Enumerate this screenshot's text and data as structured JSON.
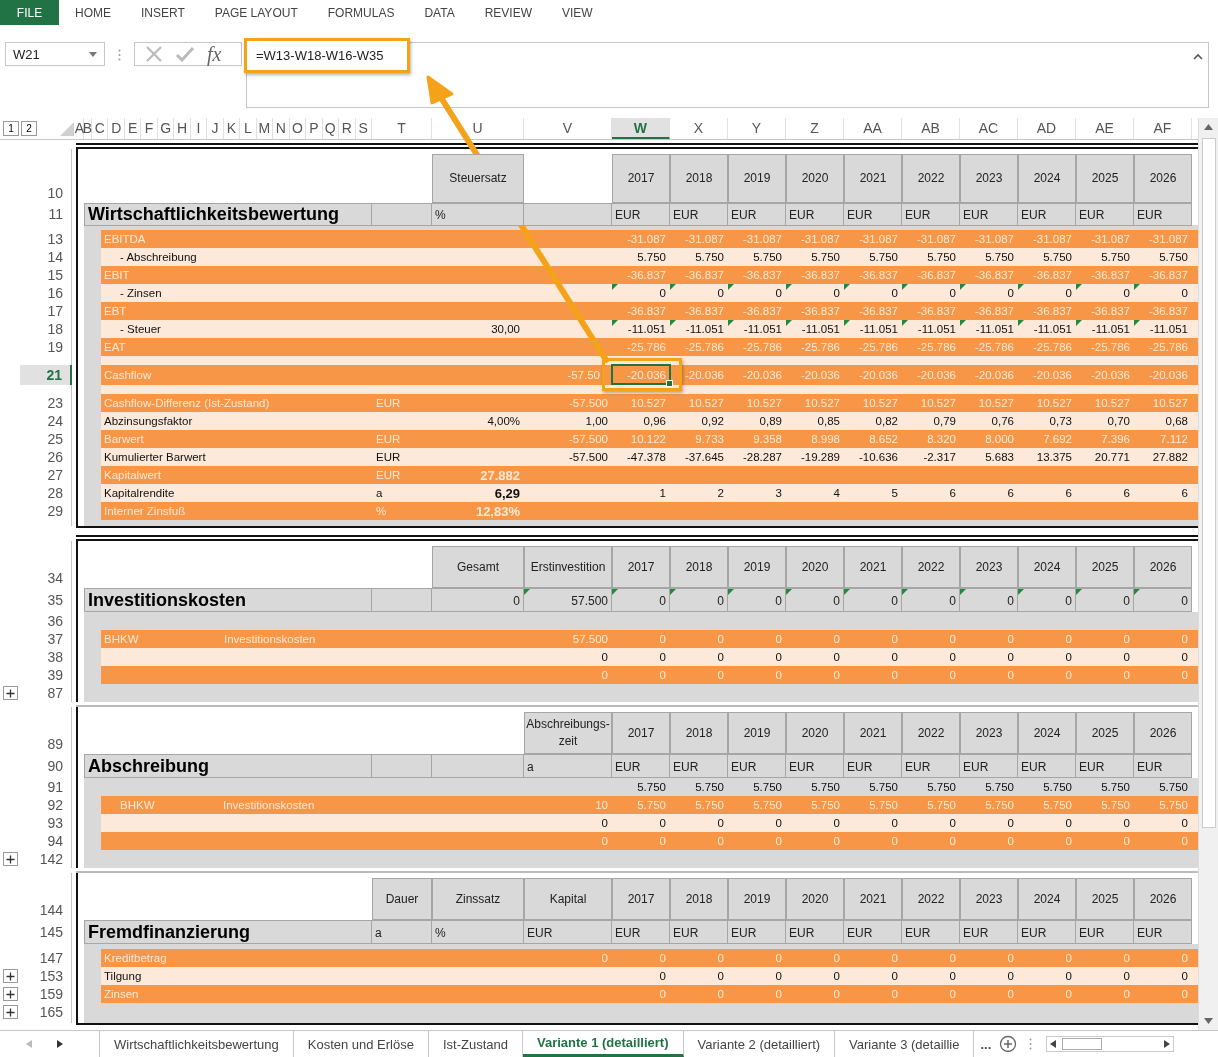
{
  "menu": {
    "file": "FILE",
    "tabs": [
      "HOME",
      "INSERT",
      "PAGE LAYOUT",
      "FORMULAS",
      "DATA",
      "REVIEW",
      "VIEW"
    ]
  },
  "formula_bar": {
    "name_box": "W21",
    "function_symbol": "fx",
    "formula": "=W13-W18-W16-W35"
  },
  "outline_levels": [
    "1",
    "2"
  ],
  "columns": [
    {
      "label": "A",
      "selected": false
    },
    {
      "label": "B",
      "selected": false
    },
    {
      "label": "C",
      "selected": false
    },
    {
      "label": "D",
      "selected": false
    },
    {
      "label": "E",
      "selected": false
    },
    {
      "label": "F",
      "selected": false
    },
    {
      "label": "G",
      "selected": false
    },
    {
      "label": "H",
      "selected": false
    },
    {
      "label": "I",
      "selected": false
    },
    {
      "label": "J",
      "selected": false
    },
    {
      "label": "K",
      "selected": false
    },
    {
      "label": "L",
      "selected": false
    },
    {
      "label": "M",
      "selected": false
    },
    {
      "label": "N",
      "selected": false
    },
    {
      "label": "O",
      "selected": false
    },
    {
      "label": "P",
      "selected": false
    },
    {
      "label": "Q",
      "selected": false
    },
    {
      "label": "R",
      "selected": false
    },
    {
      "label": "S",
      "selected": false
    },
    {
      "label": "T",
      "selected": false
    },
    {
      "label": "U",
      "selected": false
    },
    {
      "label": "V",
      "selected": false
    },
    {
      "label": "W",
      "selected": true
    },
    {
      "label": "X",
      "selected": false
    },
    {
      "label": "Y",
      "selected": false
    },
    {
      "label": "Z",
      "selected": false
    },
    {
      "label": "AA",
      "selected": false
    },
    {
      "label": "AB",
      "selected": false
    },
    {
      "label": "AC",
      "selected": false
    },
    {
      "label": "AD",
      "selected": false
    },
    {
      "label": "AE",
      "selected": false
    },
    {
      "label": "AF",
      "selected": false
    }
  ],
  "sections": [
    {
      "header": {
        "num": "10",
        "u": "Steuersatz",
        "years": [
          "2017",
          "2018",
          "2019",
          "2020",
          "2021",
          "2022",
          "2023",
          "2024",
          "2025",
          "2026"
        ]
      },
      "title": {
        "num": "11",
        "text": "Wirtschaftlichkeitsbewertung",
        "u": "%",
        "numeric": false,
        "flagged": false,
        "years": [
          "EUR",
          "EUR",
          "EUR",
          "EUR",
          "EUR",
          "EUR",
          "EUR",
          "EUR",
          "EUR",
          "EUR"
        ]
      },
      "rows": [
        {
          "num": "13",
          "kind": "orange",
          "label": "EBITDA",
          "sub": false,
          "flagged": false,
          "selected": false,
          "collapsed": false,
          "years": [
            "-31.087",
            "-31.087",
            "-31.087",
            "-31.087",
            "-31.087",
            "-31.087",
            "-31.087",
            "-31.087",
            "-31.087",
            "-31.087"
          ]
        },
        {
          "num": "14",
          "kind": "light",
          "label": "- Abschreibung",
          "sub": true,
          "flagged": false,
          "selected": false,
          "collapsed": false,
          "years": [
            "5.750",
            "5.750",
            "5.750",
            "5.750",
            "5.750",
            "5.750",
            "5.750",
            "5.750",
            "5.750",
            "5.750"
          ]
        },
        {
          "num": "15",
          "kind": "orange",
          "label": "EBIT",
          "sub": false,
          "flagged": false,
          "selected": false,
          "collapsed": false,
          "years": [
            "-36.837",
            "-36.837",
            "-36.837",
            "-36.837",
            "-36.837",
            "-36.837",
            "-36.837",
            "-36.837",
            "-36.837",
            "-36.837"
          ]
        },
        {
          "num": "16",
          "kind": "light",
          "label": "- Zinsen",
          "sub": true,
          "flagged": true,
          "selected": false,
          "collapsed": false,
          "years": [
            "0",
            "0",
            "0",
            "0",
            "0",
            "0",
            "0",
            "0",
            "0",
            "0"
          ]
        },
        {
          "num": "17",
          "kind": "orange",
          "label": "EBT",
          "sub": false,
          "flagged": false,
          "selected": false,
          "collapsed": false,
          "years": [
            "-36.837",
            "-36.837",
            "-36.837",
            "-36.837",
            "-36.837",
            "-36.837",
            "-36.837",
            "-36.837",
            "-36.837",
            "-36.837"
          ]
        },
        {
          "num": "18",
          "kind": "light",
          "label": "- Steuer",
          "sub": true,
          "u": "30,00",
          "emphasis": false,
          "flagged": true,
          "selected": false,
          "collapsed": false,
          "years": [
            "-11.051",
            "-11.051",
            "-11.051",
            "-11.051",
            "-11.051",
            "-11.051",
            "-11.051",
            "-11.051",
            "-11.051",
            "-11.051"
          ]
        },
        {
          "num": "19",
          "kind": "orange",
          "label": "EAT",
          "sub": false,
          "flagged": false,
          "selected": false,
          "collapsed": false,
          "years": [
            "-25.786",
            "-25.786",
            "-25.786",
            "-25.786",
            "-25.786",
            "-25.786",
            "-25.786",
            "-25.786",
            "-25.786",
            "-25.786"
          ]
        },
        {
          "kind": "light",
          "selected": false,
          "collapsed": false
        },
        {
          "num": "21",
          "kind": "orange",
          "label": "Cashflow",
          "sub": false,
          "v": "-57.50",
          "flagged": false,
          "selected": true,
          "collapsed": false,
          "years": [
            "-20.036",
            "-20.036",
            "-20.036",
            "-20.036",
            "-20.036",
            "-20.036",
            "-20.036",
            "-20.036",
            "-20.036",
            "-20.036"
          ]
        },
        {
          "kind": "light",
          "selected": false,
          "collapsed": false
        },
        {
          "num": "23",
          "kind": "orange",
          "label": "Cashflow-Differenz (Ist-Zustand)",
          "sub": false,
          "t": "EUR",
          "v": "-57.500",
          "flagged": false,
          "selected": false,
          "collapsed": false,
          "years": [
            "10.527",
            "10.527",
            "10.527",
            "10.527",
            "10.527",
            "10.527",
            "10.527",
            "10.527",
            "10.527",
            "10.527"
          ]
        },
        {
          "num": "24",
          "kind": "light",
          "label": "Abzinsungsfaktor",
          "sub": false,
          "u": "4,00%",
          "emphasis": false,
          "v": "1,00",
          "flagged": false,
          "selected": false,
          "collapsed": false,
          "years": [
            "0,96",
            "0,92",
            "0,89",
            "0,85",
            "0,82",
            "0,79",
            "0,76",
            "0,73",
            "0,70",
            "0,68"
          ]
        },
        {
          "num": "25",
          "kind": "orange",
          "label": "Barwert",
          "sub": false,
          "t": "EUR",
          "v": "-57.500",
          "flagged": false,
          "selected": false,
          "collapsed": false,
          "years": [
            "10.122",
            "9.733",
            "9.358",
            "8.998",
            "8.652",
            "8.320",
            "8.000",
            "7.692",
            "7.396",
            "7.112"
          ]
        },
        {
          "num": "26",
          "kind": "light",
          "label": "Kumulierter Barwert",
          "sub": false,
          "t": "EUR",
          "v": "-57.500",
          "flagged": false,
          "selected": false,
          "collapsed": false,
          "years": [
            "-47.378",
            "-37.645",
            "-28.287",
            "-19.289",
            "-10.636",
            "-2.317",
            "5.683",
            "13.375",
            "20.771",
            "27.882"
          ]
        },
        {
          "num": "27",
          "kind": "orange",
          "label": "Kapitalwert",
          "sub": false,
          "t": "EUR",
          "u": "27.882",
          "emphasis": true,
          "selected": false,
          "collapsed": false
        },
        {
          "num": "28",
          "kind": "light",
          "label": "Kapitalrendite",
          "sub": false,
          "t": "a",
          "u": "6,29",
          "emphasis": true,
          "flagged": false,
          "selected": false,
          "collapsed": false,
          "years": [
            "1",
            "2",
            "3",
            "4",
            "5",
            "6",
            "6",
            "6",
            "6",
            "6"
          ]
        },
        {
          "num": "29",
          "kind": "orange",
          "label": "Interner Zinsfuß",
          "sub": false,
          "t": "%",
          "u": "12,83%",
          "emphasis": true,
          "selected": false,
          "collapsed": false
        }
      ]
    },
    {
      "header": {
        "num": "34",
        "u": "Gesamt",
        "v": "Erstinvestition",
        "years": [
          "2017",
          "2018",
          "2019",
          "2020",
          "2021",
          "2022",
          "2023",
          "2024",
          "2025",
          "2026"
        ]
      },
      "title": {
        "num": "35",
        "text": "Investitionskosten",
        "u": "0",
        "v": "57.500",
        "numeric": true,
        "flagged": true,
        "years": [
          "0",
          "0",
          "0",
          "0",
          "0",
          "0",
          "0",
          "0",
          "0",
          "0"
        ]
      },
      "rows": [
        {
          "num": "36",
          "kind": "gray",
          "selected": false,
          "collapsed": false
        },
        {
          "num": "37",
          "kind": "orange",
          "label": "BHKW",
          "label2": "Investitionskosten",
          "sub": false,
          "v": "57.500",
          "flagged": false,
          "selected": false,
          "collapsed": false,
          "years": [
            "0",
            "0",
            "0",
            "0",
            "0",
            "0",
            "0",
            "0",
            "0",
            "0"
          ]
        },
        {
          "num": "38",
          "kind": "light",
          "v": "0",
          "flagged": false,
          "selected": false,
          "collapsed": false,
          "years": [
            "0",
            "0",
            "0",
            "0",
            "0",
            "0",
            "0",
            "0",
            "0",
            "0"
          ]
        },
        {
          "num": "39",
          "kind": "orange",
          "v": "0",
          "flagged": false,
          "selected": false,
          "collapsed": false,
          "years": [
            "0",
            "0",
            "0",
            "0",
            "0",
            "0",
            "0",
            "0",
            "0",
            "0"
          ]
        },
        {
          "num": "87",
          "kind": "gray",
          "selected": false,
          "collapsed": true
        }
      ]
    },
    {
      "header": {
        "num": "89",
        "v": "Abschreibungs-zeit",
        "years": [
          "2017",
          "2018",
          "2019",
          "2020",
          "2021",
          "2022",
          "2023",
          "2024",
          "2025",
          "2026"
        ]
      },
      "title": {
        "num": "90",
        "text": "Abschreibung",
        "v": "a",
        "numeric": false,
        "flagged": false,
        "years": [
          "EUR",
          "EUR",
          "EUR",
          "EUR",
          "EUR",
          "EUR",
          "EUR",
          "EUR",
          "EUR",
          "EUR"
        ]
      },
      "rows": [
        {
          "num": "91",
          "kind": "gray",
          "flagged": false,
          "selected": false,
          "collapsed": false,
          "years": [
            "5.750",
            "5.750",
            "5.750",
            "5.750",
            "5.750",
            "5.750",
            "5.750",
            "5.750",
            "5.750",
            "5.750"
          ]
        },
        {
          "num": "92",
          "kind": "orange",
          "label": "BHKW",
          "label2": "Investitionskosten",
          "sub": true,
          "v": "10",
          "flagged": false,
          "selected": false,
          "collapsed": false,
          "years": [
            "5.750",
            "5.750",
            "5.750",
            "5.750",
            "5.750",
            "5.750",
            "5.750",
            "5.750",
            "5.750",
            "5.750"
          ]
        },
        {
          "num": "93",
          "kind": "light",
          "v": "0",
          "flagged": false,
          "selected": false,
          "collapsed": false,
          "years": [
            "0",
            "0",
            "0",
            "0",
            "0",
            "0",
            "0",
            "0",
            "0",
            "0"
          ]
        },
        {
          "num": "94",
          "kind": "orange",
          "v": "0",
          "flagged": false,
          "selected": false,
          "collapsed": false,
          "years": [
            "0",
            "0",
            "0",
            "0",
            "0",
            "0",
            "0",
            "0",
            "0",
            "0"
          ]
        },
        {
          "num": "142",
          "kind": "gray",
          "selected": false,
          "collapsed": true
        }
      ]
    },
    {
      "header": {
        "num": "144",
        "t": "Dauer",
        "u": "Zinssatz",
        "v": "Kapital",
        "years": [
          "2017",
          "2018",
          "2019",
          "2020",
          "2021",
          "2022",
          "2023",
          "2024",
          "2025",
          "2026"
        ]
      },
      "title": {
        "num": "145",
        "text": "Fremdfinanzierung",
        "t": "a",
        "u": "%",
        "v": "EUR",
        "numeric": false,
        "flagged": false,
        "years": [
          "EUR",
          "EUR",
          "EUR",
          "EUR",
          "EUR",
          "EUR",
          "EUR",
          "EUR",
          "EUR",
          "EUR"
        ]
      },
      "rows": [
        {
          "num": "147",
          "kind": "orange",
          "label": "Kreditbetrag",
          "sub": false,
          "v": "0",
          "flagged": false,
          "selected": false,
          "collapsed": false,
          "years": [
            "0",
            "0",
            "0",
            "0",
            "0",
            "0",
            "0",
            "0",
            "0",
            "0"
          ]
        },
        {
          "num": "153",
          "kind": "light",
          "label": "Tilgung",
          "sub": false,
          "flagged": false,
          "selected": false,
          "collapsed": true,
          "years": [
            "0",
            "0",
            "0",
            "0",
            "0",
            "0",
            "0",
            "0",
            "0",
            "0"
          ]
        },
        {
          "num": "159",
          "kind": "orange",
          "label": "Zinsen",
          "sub": false,
          "flagged": false,
          "selected": false,
          "collapsed": true,
          "years": [
            "0",
            "0",
            "0",
            "0",
            "0",
            "0",
            "0",
            "0",
            "0",
            "0"
          ]
        },
        {
          "num": "165",
          "kind": "gray",
          "selected": false,
          "collapsed": true
        }
      ]
    }
  ],
  "sheet_tabs": [
    {
      "label": "Wirtschaftlichkeitsbewertung",
      "selected": false
    },
    {
      "label": "Kosten und Erlöse",
      "selected": false
    },
    {
      "label": "Ist-Zustand",
      "selected": false
    },
    {
      "label": "Variante 1 (detailliert)",
      "selected": true
    },
    {
      "label": "Variante 2 (detailliert)",
      "selected": false
    },
    {
      "label": "Variante 3 (detaillie",
      "selected": false
    }
  ],
  "tabs_overflow": "..."
}
